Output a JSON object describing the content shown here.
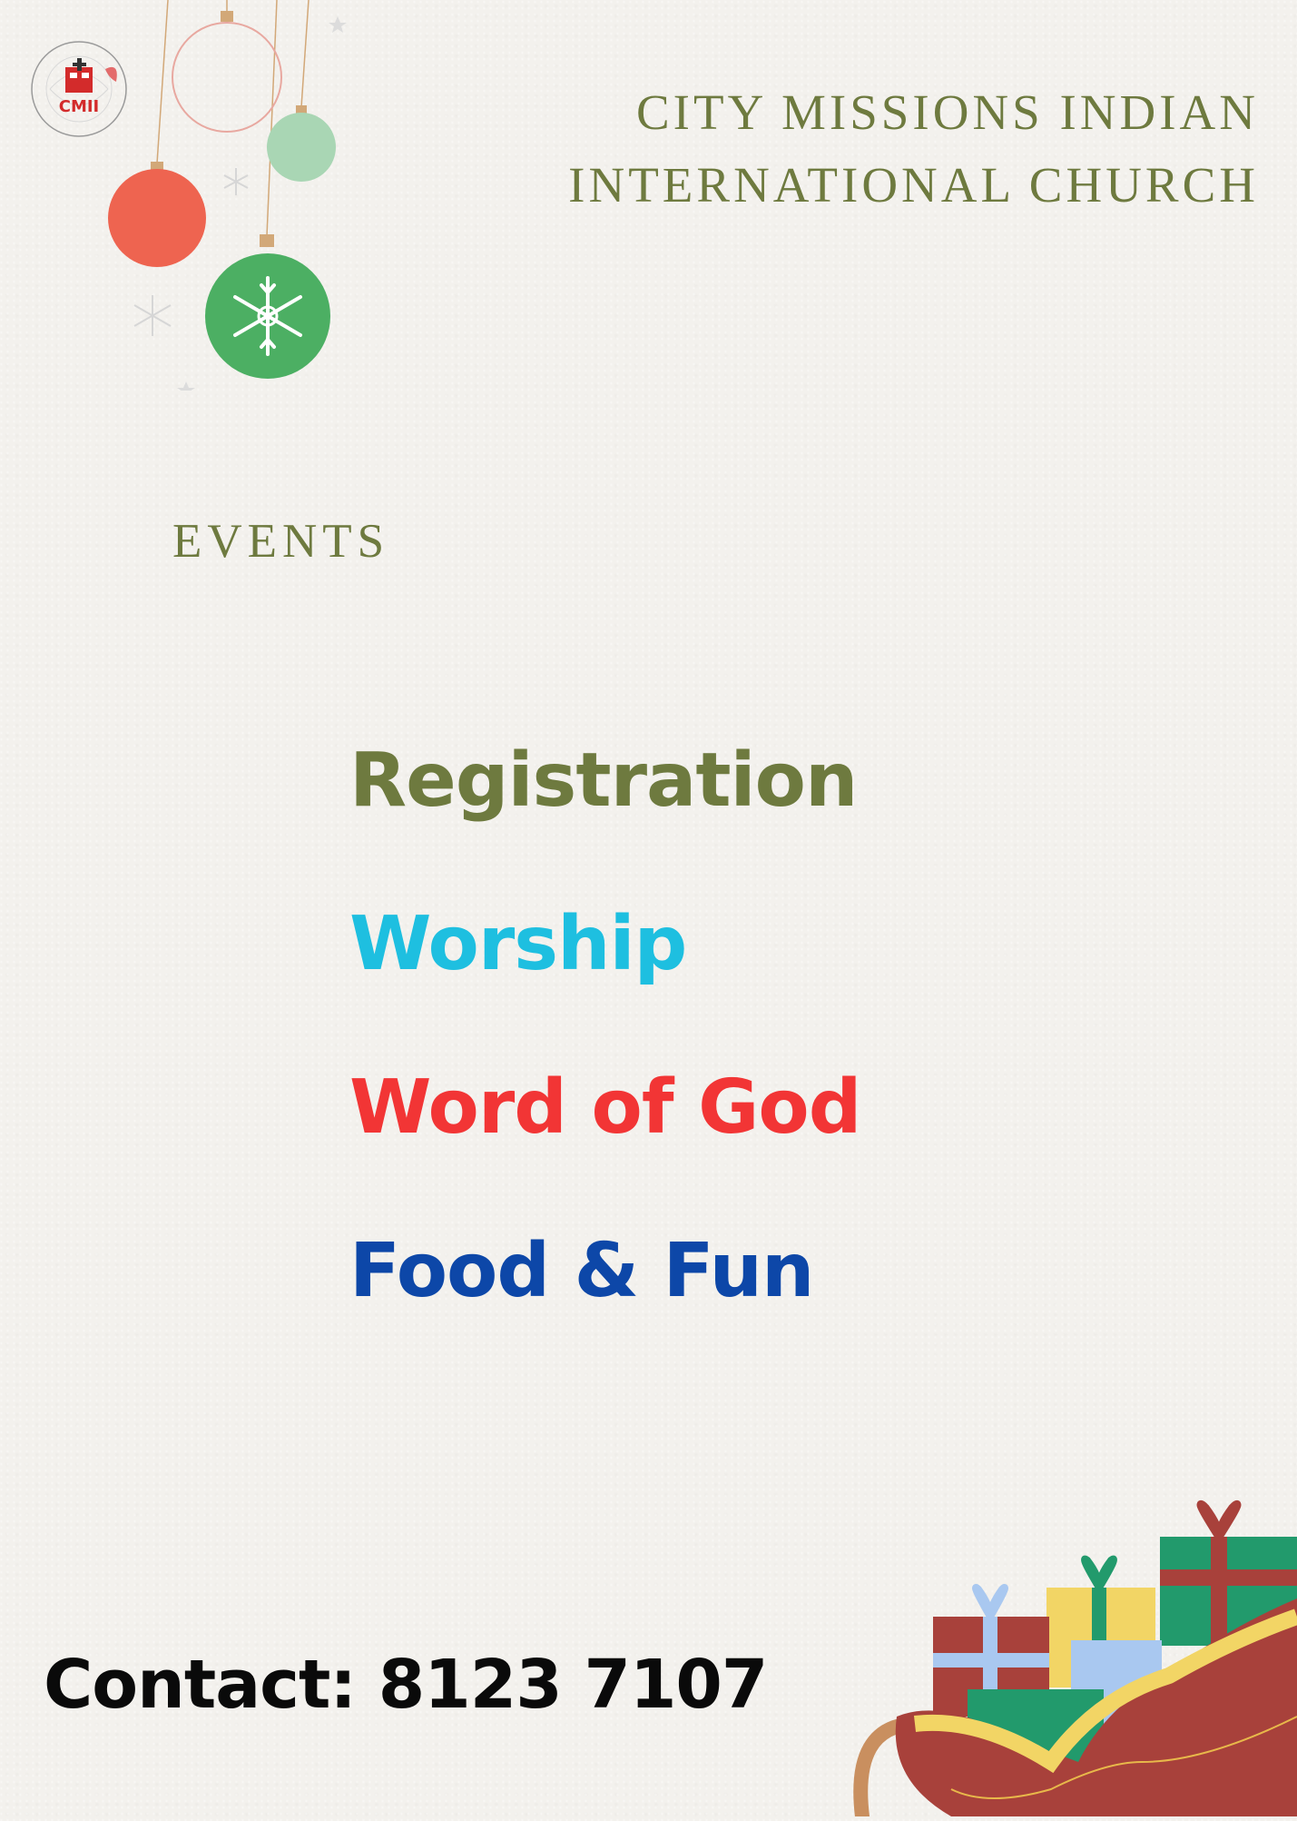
{
  "header": {
    "logo_text": "CMII",
    "logo_ring_text": "CITY MISSIONS INDIAN INTERNATIONAL CHURCH",
    "church_name_line1": "CITY MISSIONS INDIAN",
    "church_name_line2": "INTERNATIONAL CHURCH"
  },
  "events": {
    "heading": "EVENTS",
    "items": [
      {
        "label": "Registration",
        "color": "#6e7a3f"
      },
      {
        "label": "Worship",
        "color": "#1ebfe0"
      },
      {
        "label": "Word of God",
        "color": "#f23535"
      },
      {
        "label": "Food & Fun",
        "color": "#0d47a8"
      }
    ]
  },
  "footer": {
    "contact": "Contact: 8123 7107"
  },
  "decorations": {
    "icons": [
      "ornament-outline-icon",
      "ornament-green-icon",
      "ornament-red-icon",
      "ornament-snowflake-icon",
      "sleigh-icon",
      "gift-icon"
    ],
    "colors": {
      "olive": "#6e7a3f",
      "red_ornament": "#ee6450",
      "green_ornament": "#4caf63",
      "mint_ornament": "#a9d6b4",
      "sleigh_red": "#a8413b",
      "sleigh_yellow": "#f2d565",
      "gift_green": "#229a6c"
    }
  }
}
